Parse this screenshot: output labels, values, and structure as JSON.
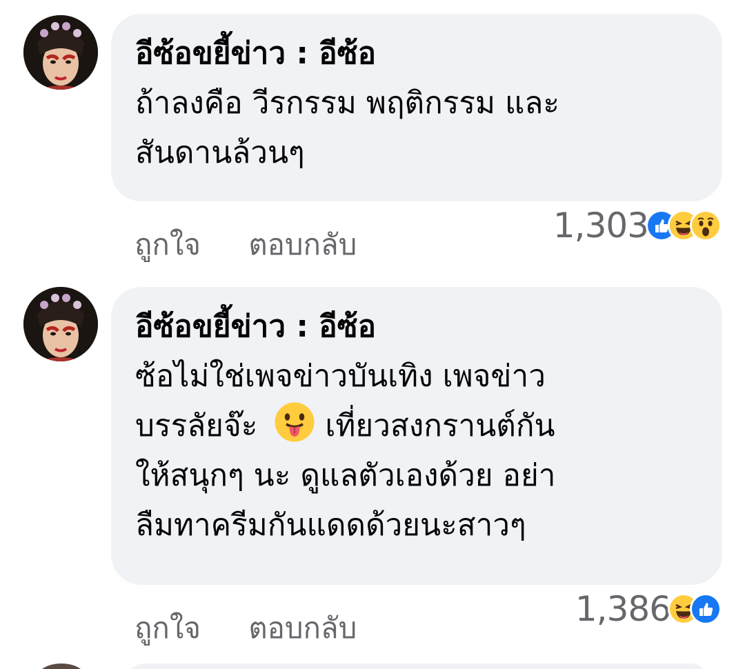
{
  "comments": [
    {
      "author": "อีซ้อขยี้ข่าว : อีซ้อ",
      "lines": [
        "ถ้าลงคือ วีรกรรม พฤติกรรม และ",
        "สันดานล้วนๆ"
      ],
      "like_label": "ถูกใจ",
      "reply_label": "ตอบกลับ",
      "reaction_count": "1,303",
      "reactions": [
        "like-icon",
        "haha-icon",
        "wow-icon"
      ]
    },
    {
      "author": "อีซ้อขยี้ข่าว : อีซ้อ",
      "line1": "ซ้อไม่ใช่เพจข่าวบันเทิง เพจข่าว",
      "line2_before_emoji": "บรรลัยจ๊ะ",
      "inline_emoji": "tongue-out-emoji",
      "line2_after_emoji": "เที่ยวสงกรานต์กัน",
      "line3": "ให้สนุกๆ นะ ดูแลตัวเองด้วย อย่า",
      "line4": "ลืมทาครีมกันแดดด้วยนะสาวๆ",
      "like_label": "ถูกใจ",
      "reply_label": "ตอบกลับ",
      "reaction_count": "1,386",
      "reactions": [
        "haha-icon",
        "like-icon"
      ]
    }
  ],
  "colors": {
    "bubble": "#f0f2f5",
    "meta_text": "#65676b",
    "like_blue": "#1877f2",
    "emoji_yellow": "#ffcc3e"
  }
}
